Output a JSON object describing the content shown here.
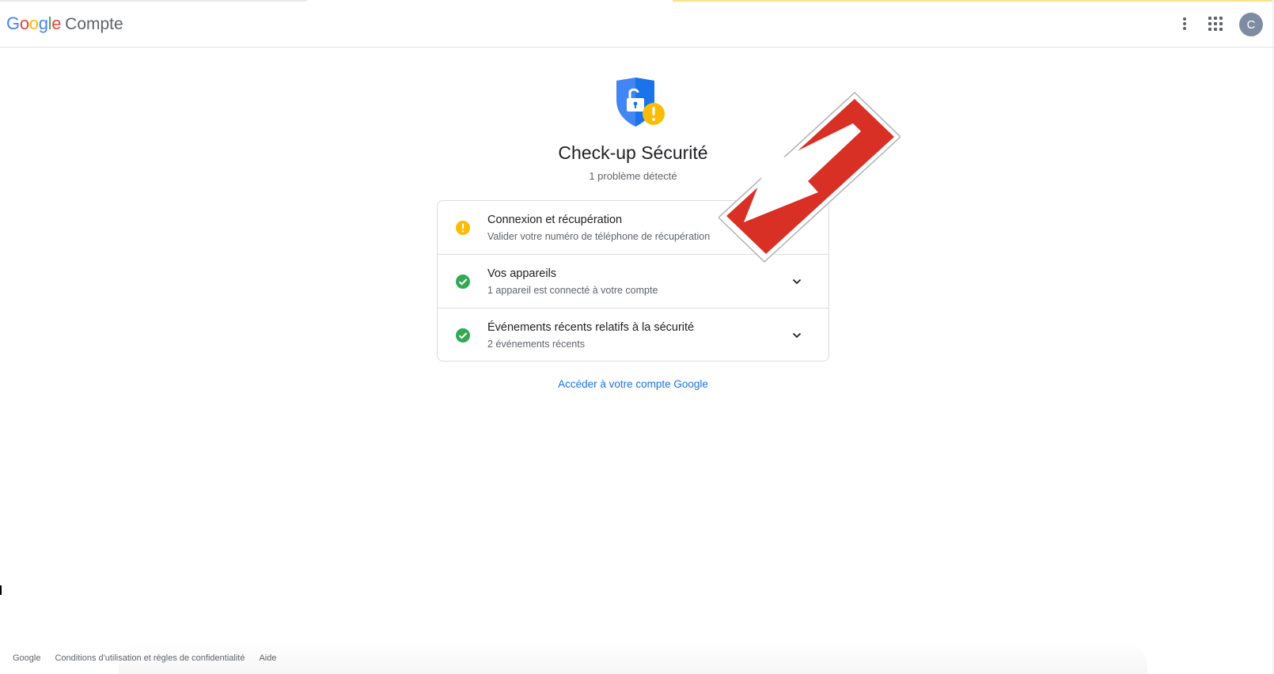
{
  "header": {
    "brand_logo": "Google",
    "product_name": "Compte",
    "menu_icon": "more-vert-icon",
    "apps_icon": "apps-grid-icon",
    "avatar_initial": "C"
  },
  "hero": {
    "icon": "shield-unlock-warning-icon",
    "title": "Check-up Sécurité",
    "subtitle": "1 problème détecté"
  },
  "checks": [
    {
      "status": "warning",
      "title": "Connexion et récupération",
      "description": "Valider votre numéro de téléphone de récupération"
    },
    {
      "status": "ok",
      "title": "Vos appareils",
      "description": "1 appareil est connecté à votre compte"
    },
    {
      "status": "ok",
      "title": "Événements récents relatifs à la sécurité",
      "description": "2 événements récents"
    }
  ],
  "account_link": "Accéder à votre compte Google",
  "footer": {
    "links": [
      "Google",
      "Conditions d'utilisation et règles de confidentialité",
      "Aide"
    ]
  },
  "colors": {
    "warning": "#fbbc04",
    "ok": "#34a853",
    "link": "#1a73e8",
    "shield": "#4285f4",
    "overlay_arrow": "#d93025"
  }
}
